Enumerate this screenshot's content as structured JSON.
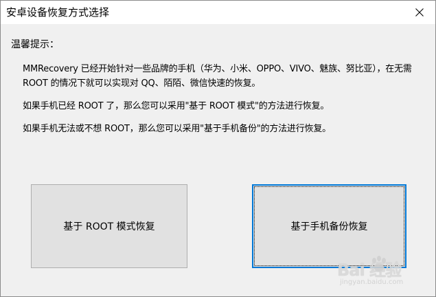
{
  "window": {
    "title": "安卓设备恢复方式选择"
  },
  "tips": {
    "heading": "温馨提示：",
    "paragraph1": "MMRecovery 已经开始针对一些品牌的手机（华为、小米、OPPO、VIVO、魅族、努比亚），在无需 ROOT 的情况下就可以实现对 QQ、陌陌、微信快速的恢复。",
    "paragraph2": "如果手机已经 ROOT 了，那么您可以采用\"基于 ROOT 模式\"的方法进行恢复。",
    "paragraph3": "如果手机无法或不想 ROOT，那么您可以采用\"基于手机备份\"的方法进行恢复。"
  },
  "buttons": {
    "root_mode": "基于 ROOT 模式恢复",
    "phone_backup": "基于手机备份恢复"
  },
  "watermark": {
    "brand": "Bai  经验",
    "url": "jingyan.baidu.com"
  },
  "colors": {
    "focus_border": "#0078d7",
    "window_bg": "#f0f0f0",
    "button_bg": "#e1e1e1"
  }
}
